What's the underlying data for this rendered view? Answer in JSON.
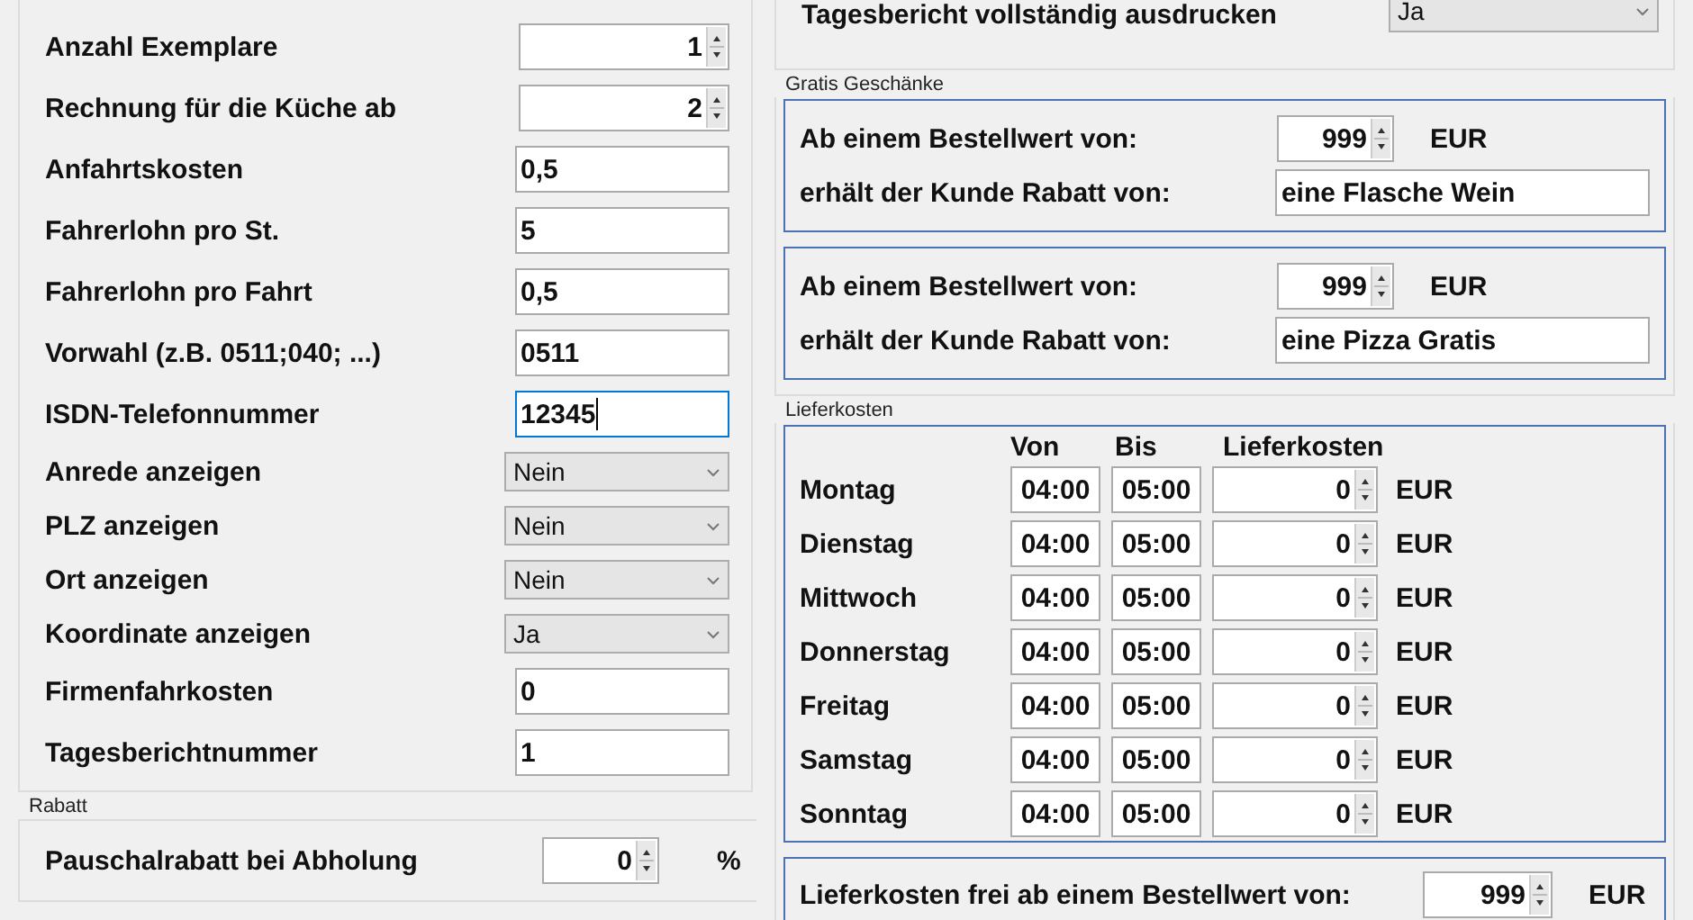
{
  "settings": [
    {
      "label": "Anzahl Exemplare",
      "kind": "spinner",
      "value": "1"
    },
    {
      "label": "Rechnung für die Küche ab",
      "kind": "spinner",
      "value": "2"
    },
    {
      "label": "Anfahrtskosten",
      "kind": "text",
      "value": "0,5",
      "focused": false
    },
    {
      "label": "Fahrerlohn pro St.",
      "kind": "text",
      "value": "5",
      "focused": false
    },
    {
      "label": "Fahrerlohn pro Fahrt",
      "kind": "text",
      "value": "0,5",
      "focused": false
    },
    {
      "label": "Vorwahl (z.B. 0511;040; ...)",
      "kind": "text",
      "value": "0511",
      "focused": false
    },
    {
      "label": "ISDN-Telefonnummer",
      "kind": "text",
      "value": "12345",
      "focused": true
    },
    {
      "label": "Anrede anzeigen",
      "kind": "dropdown",
      "value": "Nein"
    },
    {
      "label": "PLZ anzeigen",
      "kind": "dropdown",
      "value": "Nein"
    },
    {
      "label": "Ort anzeigen",
      "kind": "dropdown",
      "value": "Nein"
    },
    {
      "label": "Koordinate anzeigen",
      "kind": "dropdown",
      "value": "Ja"
    },
    {
      "label": "Firmenfahrkosten",
      "kind": "text",
      "value": "0",
      "focused": false
    },
    {
      "label": "Tagesberichtnummer",
      "kind": "text",
      "value": "1",
      "focused": false
    }
  ],
  "rabatt": {
    "title": "Rabatt",
    "rows": [
      {
        "label": "Pauschalrabatt bei Abholung",
        "value": "0",
        "unit": "%"
      }
    ]
  },
  "report": {
    "label": "Tagesbericht vollständig ausdrucken",
    "value": "Ja"
  },
  "gifts": {
    "title": "Gratis Geschänke",
    "items": [
      {
        "threshold_label": "Ab einem Bestellwert von:",
        "threshold": "999",
        "unit": "EUR",
        "reward_label": "erhält der Kunde Rabatt von:",
        "reward": "eine Flasche Wein"
      },
      {
        "threshold_label": "Ab einem Bestellwert von:",
        "threshold": "999",
        "unit": "EUR",
        "reward_label": "erhält der Kunde Rabatt von:",
        "reward": "eine Pizza Gratis"
      }
    ]
  },
  "delivery": {
    "title": "Lieferkosten",
    "columns": [
      "Von",
      "Bis",
      "Lieferkosten"
    ],
    "rows": [
      {
        "day": "Montag",
        "from": "04:00",
        "to": "05:00",
        "cost": "0",
        "unit": "EUR"
      },
      {
        "day": "Dienstag",
        "from": "04:00",
        "to": "05:00",
        "cost": "0",
        "unit": "EUR"
      },
      {
        "day": "Mittwoch",
        "from": "04:00",
        "to": "05:00",
        "cost": "0",
        "unit": "EUR"
      },
      {
        "day": "Donnerstag",
        "from": "04:00",
        "to": "05:00",
        "cost": "0",
        "unit": "EUR"
      },
      {
        "day": "Freitag",
        "from": "04:00",
        "to": "05:00",
        "cost": "0",
        "unit": "EUR"
      },
      {
        "day": "Samstag",
        "from": "04:00",
        "to": "05:00",
        "cost": "0",
        "unit": "EUR"
      },
      {
        "day": "Sonntag",
        "from": "04:00",
        "to": "05:00",
        "cost": "0",
        "unit": "EUR"
      }
    ],
    "free": {
      "label": "Lieferkosten frei ab einem Bestellwert von:",
      "value": "999",
      "unit": "EUR"
    }
  }
}
